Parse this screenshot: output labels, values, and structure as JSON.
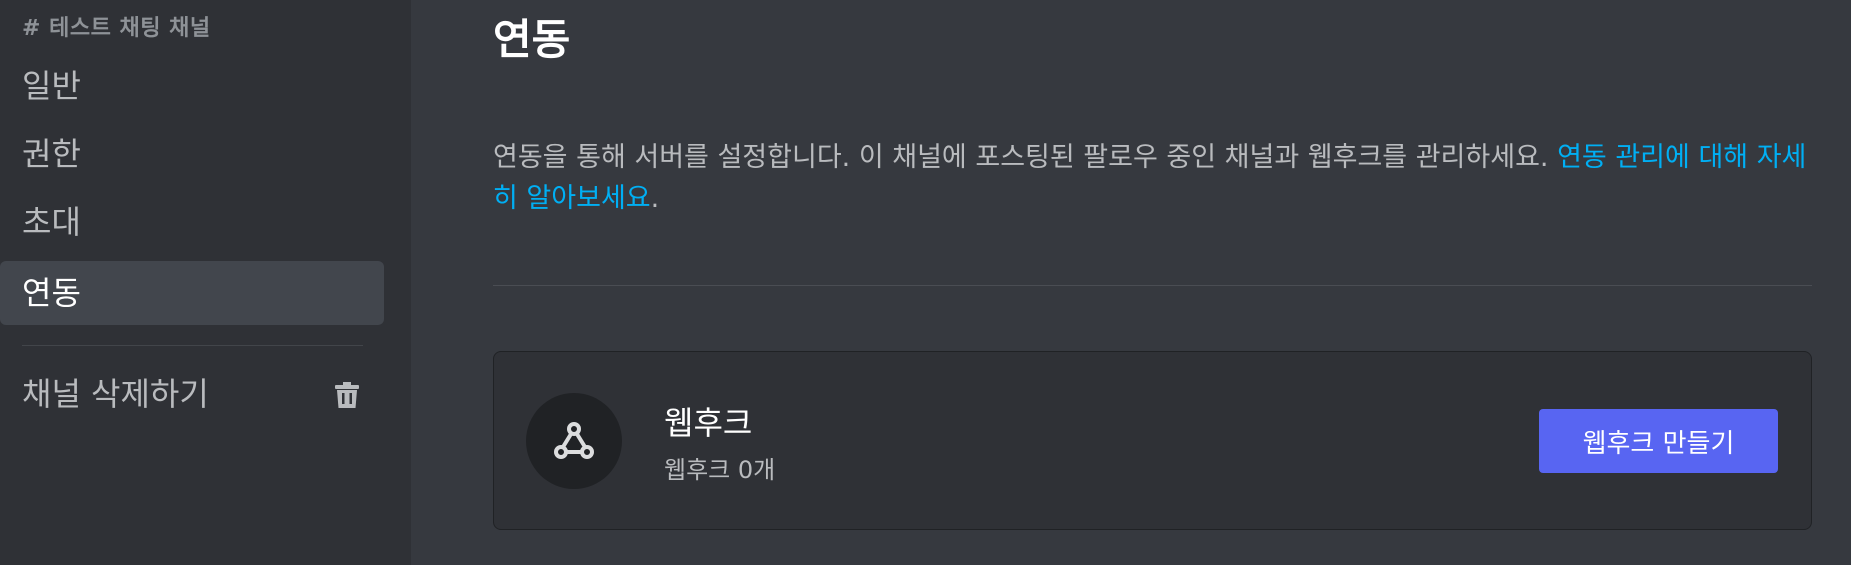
{
  "sidebar": {
    "channel_header": "# 테스트 채팅 채널",
    "items": [
      {
        "label": "일반"
      },
      {
        "label": "권한"
      },
      {
        "label": "초대"
      },
      {
        "label": "연동"
      }
    ],
    "delete_label": "채널 삭제하기"
  },
  "main": {
    "title": "연동",
    "description": "연동을 통해 서버를 설정합니다. 이 채널에 포스팅된 팔로우 중인 채널과 웹후크를 관리하세요. ",
    "learn_more_link": "연동 관리에 대해 자세히 알아보세요",
    "description_end": ".",
    "webhook": {
      "title": "웹후크",
      "count": "웹후크 0개",
      "create_button": "웹후크 만들기",
      "icon": "webhook-icon"
    }
  },
  "colors": {
    "sidebar_bg": "#2f3136",
    "main_bg": "#36393f",
    "accent": "#5865f2",
    "link": "#00aff4",
    "selected_bg": "#42464d"
  }
}
